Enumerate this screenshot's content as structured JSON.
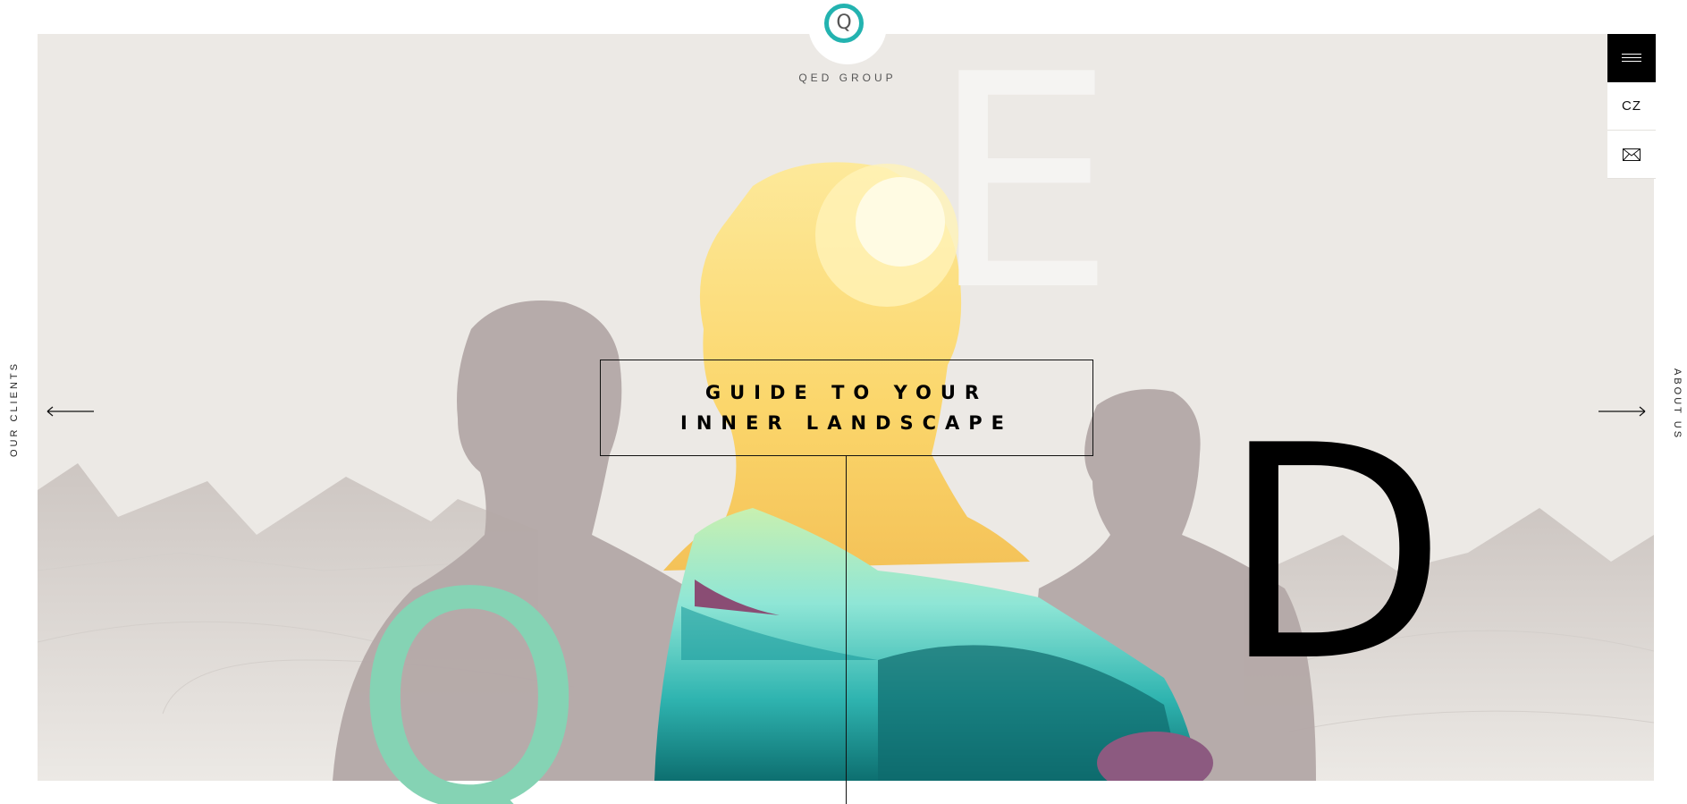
{
  "brand": {
    "name": "QED GROUP",
    "logo_letter": "Q",
    "accent": "#23b3b0"
  },
  "toolbar": {
    "menu_icon": "hamburger-icon",
    "lang_label": "CZ",
    "mail_icon": "mail-icon"
  },
  "nav": {
    "left_label": "OUR CLIENTS",
    "right_label": "ABOUT US",
    "left_arrow_icon": "arrow-left-icon",
    "right_arrow_icon": "arrow-right-icon"
  },
  "hero": {
    "headline_line1": "GUIDE TO YOUR",
    "headline_line2": "INNER LANDSCAPE",
    "letters": {
      "q": "Q",
      "e": "E",
      "d": "D"
    },
    "colors": {
      "q": "#85d3b4",
      "e": "#f5f4f2",
      "d": "#000000"
    }
  }
}
